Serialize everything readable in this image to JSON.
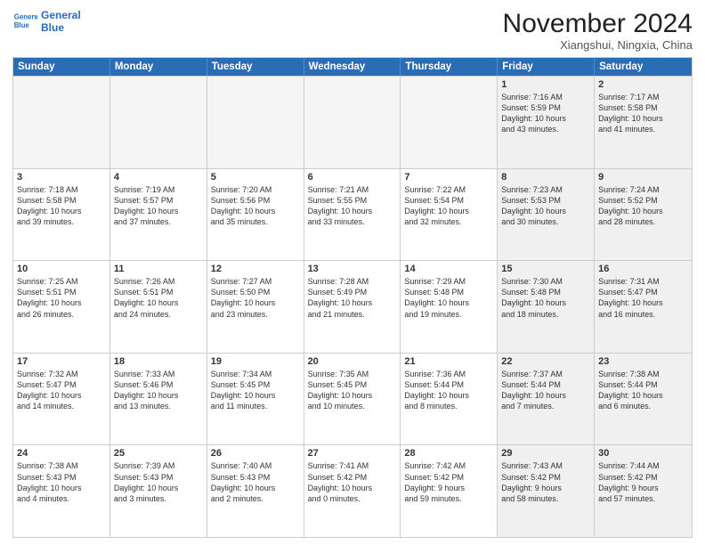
{
  "logo": {
    "line1": "General",
    "line2": "Blue"
  },
  "title": "November 2024",
  "location": "Xiangshui, Ningxia, China",
  "days_of_week": [
    "Sunday",
    "Monday",
    "Tuesday",
    "Wednesday",
    "Thursday",
    "Friday",
    "Saturday"
  ],
  "weeks": [
    [
      {
        "day": "",
        "info": "",
        "empty": true
      },
      {
        "day": "",
        "info": "",
        "empty": true
      },
      {
        "day": "",
        "info": "",
        "empty": true
      },
      {
        "day": "",
        "info": "",
        "empty": true
      },
      {
        "day": "",
        "info": "",
        "empty": true
      },
      {
        "day": "1",
        "info": "Sunrise: 7:16 AM\nSunset: 5:59 PM\nDaylight: 10 hours\nand 43 minutes.",
        "shaded": true
      },
      {
        "day": "2",
        "info": "Sunrise: 7:17 AM\nSunset: 5:58 PM\nDaylight: 10 hours\nand 41 minutes.",
        "shaded": true
      }
    ],
    [
      {
        "day": "3",
        "info": "Sunrise: 7:18 AM\nSunset: 5:58 PM\nDaylight: 10 hours\nand 39 minutes."
      },
      {
        "day": "4",
        "info": "Sunrise: 7:19 AM\nSunset: 5:57 PM\nDaylight: 10 hours\nand 37 minutes."
      },
      {
        "day": "5",
        "info": "Sunrise: 7:20 AM\nSunset: 5:56 PM\nDaylight: 10 hours\nand 35 minutes."
      },
      {
        "day": "6",
        "info": "Sunrise: 7:21 AM\nSunset: 5:55 PM\nDaylight: 10 hours\nand 33 minutes."
      },
      {
        "day": "7",
        "info": "Sunrise: 7:22 AM\nSunset: 5:54 PM\nDaylight: 10 hours\nand 32 minutes."
      },
      {
        "day": "8",
        "info": "Sunrise: 7:23 AM\nSunset: 5:53 PM\nDaylight: 10 hours\nand 30 minutes.",
        "shaded": true
      },
      {
        "day": "9",
        "info": "Sunrise: 7:24 AM\nSunset: 5:52 PM\nDaylight: 10 hours\nand 28 minutes.",
        "shaded": true
      }
    ],
    [
      {
        "day": "10",
        "info": "Sunrise: 7:25 AM\nSunset: 5:51 PM\nDaylight: 10 hours\nand 26 minutes."
      },
      {
        "day": "11",
        "info": "Sunrise: 7:26 AM\nSunset: 5:51 PM\nDaylight: 10 hours\nand 24 minutes."
      },
      {
        "day": "12",
        "info": "Sunrise: 7:27 AM\nSunset: 5:50 PM\nDaylight: 10 hours\nand 23 minutes."
      },
      {
        "day": "13",
        "info": "Sunrise: 7:28 AM\nSunset: 5:49 PM\nDaylight: 10 hours\nand 21 minutes."
      },
      {
        "day": "14",
        "info": "Sunrise: 7:29 AM\nSunset: 5:48 PM\nDaylight: 10 hours\nand 19 minutes."
      },
      {
        "day": "15",
        "info": "Sunrise: 7:30 AM\nSunset: 5:48 PM\nDaylight: 10 hours\nand 18 minutes.",
        "shaded": true
      },
      {
        "day": "16",
        "info": "Sunrise: 7:31 AM\nSunset: 5:47 PM\nDaylight: 10 hours\nand 16 minutes.",
        "shaded": true
      }
    ],
    [
      {
        "day": "17",
        "info": "Sunrise: 7:32 AM\nSunset: 5:47 PM\nDaylight: 10 hours\nand 14 minutes."
      },
      {
        "day": "18",
        "info": "Sunrise: 7:33 AM\nSunset: 5:46 PM\nDaylight: 10 hours\nand 13 minutes."
      },
      {
        "day": "19",
        "info": "Sunrise: 7:34 AM\nSunset: 5:45 PM\nDaylight: 10 hours\nand 11 minutes."
      },
      {
        "day": "20",
        "info": "Sunrise: 7:35 AM\nSunset: 5:45 PM\nDaylight: 10 hours\nand 10 minutes."
      },
      {
        "day": "21",
        "info": "Sunrise: 7:36 AM\nSunset: 5:44 PM\nDaylight: 10 hours\nand 8 minutes."
      },
      {
        "day": "22",
        "info": "Sunrise: 7:37 AM\nSunset: 5:44 PM\nDaylight: 10 hours\nand 7 minutes.",
        "shaded": true
      },
      {
        "day": "23",
        "info": "Sunrise: 7:38 AM\nSunset: 5:44 PM\nDaylight: 10 hours\nand 6 minutes.",
        "shaded": true
      }
    ],
    [
      {
        "day": "24",
        "info": "Sunrise: 7:38 AM\nSunset: 5:43 PM\nDaylight: 10 hours\nand 4 minutes."
      },
      {
        "day": "25",
        "info": "Sunrise: 7:39 AM\nSunset: 5:43 PM\nDaylight: 10 hours\nand 3 minutes."
      },
      {
        "day": "26",
        "info": "Sunrise: 7:40 AM\nSunset: 5:43 PM\nDaylight: 10 hours\nand 2 minutes."
      },
      {
        "day": "27",
        "info": "Sunrise: 7:41 AM\nSunset: 5:42 PM\nDaylight: 10 hours\nand 0 minutes."
      },
      {
        "day": "28",
        "info": "Sunrise: 7:42 AM\nSunset: 5:42 PM\nDaylight: 9 hours\nand 59 minutes."
      },
      {
        "day": "29",
        "info": "Sunrise: 7:43 AM\nSunset: 5:42 PM\nDaylight: 9 hours\nand 58 minutes.",
        "shaded": true
      },
      {
        "day": "30",
        "info": "Sunrise: 7:44 AM\nSunset: 5:42 PM\nDaylight: 9 hours\nand 57 minutes.",
        "shaded": true
      }
    ]
  ]
}
